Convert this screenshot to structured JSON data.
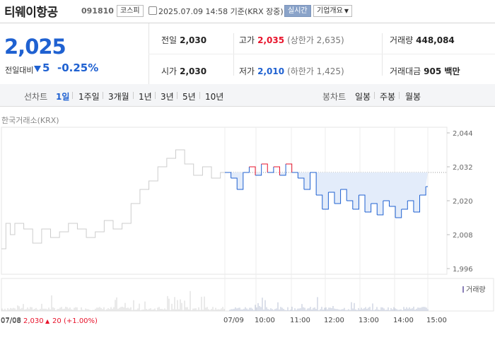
{
  "stock": {
    "name": "티웨이항공",
    "code": "091810",
    "market": "코스피",
    "datetime": "2025.07.09 14:58 기준(KRX 장중)",
    "realtime_label": "실시간",
    "company_info_label": "기업개요"
  },
  "summary": {
    "price": "2,025",
    "change_label": "전일대비",
    "change_value": "5",
    "change_rate": "-0.25%",
    "change_color": "#1f61d1",
    "prev_close": {
      "label": "전일",
      "value": "2,030"
    },
    "high": {
      "label": "고가",
      "value": "2,035",
      "sub": "(상한가 2,635)",
      "color": "#e8132b"
    },
    "volume": {
      "label": "거래량",
      "value": "448,084"
    },
    "open": {
      "label": "시가",
      "value": "2,030"
    },
    "low": {
      "label": "저가",
      "value": "2,010",
      "sub": "(하한가 1,425)",
      "color": "#1f61d1"
    },
    "trade_amount": {
      "label": "거래대금",
      "value": "905 백만"
    }
  },
  "tabs": {
    "line_chart_label": "선차트",
    "periods": [
      "1일",
      "1주일",
      "3개월",
      "1년",
      "3년",
      "5년",
      "10년"
    ],
    "active_period": "1일",
    "candle_chart_label": "봉차트",
    "candles": [
      "일봉",
      "주봉",
      "월봉"
    ]
  },
  "chart_source": "한국거래소(KRX)",
  "colors": {
    "up": "#e8132b",
    "down": "#1f61d1",
    "prev": "#cccccc",
    "fill": "#e3ecfa"
  },
  "chart_data": {
    "type": "line",
    "y_ticks": [
      "2,044",
      "2,032",
      "2,020",
      "2,008",
      "1,996"
    ],
    "ylim": [
      1996,
      2044
    ],
    "reference_price": 2030,
    "x_labels": [
      "07/08",
      "07/09",
      "10:00",
      "11:00",
      "12:00",
      "13:00",
      "14:00",
      "15:00"
    ],
    "volume_legend": "거래량",
    "prev_day_info": {
      "date": "07/08",
      "price": "2,030",
      "change": "20",
      "rate": "(+1.00%)"
    },
    "prev_day_series": [
      {
        "t": 0,
        "v": 2003
      },
      {
        "t": 0.02,
        "v": 2012
      },
      {
        "t": 0.04,
        "v": 2008
      },
      {
        "t": 0.06,
        "v": 2012
      },
      {
        "t": 0.1,
        "v": 2010
      },
      {
        "t": 0.14,
        "v": 2005
      },
      {
        "t": 0.18,
        "v": 2010
      },
      {
        "t": 0.22,
        "v": 2007
      },
      {
        "t": 0.26,
        "v": 2009
      },
      {
        "t": 0.3,
        "v": 2012
      },
      {
        "t": 0.34,
        "v": 2010
      },
      {
        "t": 0.38,
        "v": 2007
      },
      {
        "t": 0.42,
        "v": 2009
      },
      {
        "t": 0.46,
        "v": 2013
      },
      {
        "t": 0.5,
        "v": 2010
      },
      {
        "t": 0.54,
        "v": 2012
      },
      {
        "t": 0.58,
        "v": 2019
      },
      {
        "t": 0.62,
        "v": 2024
      },
      {
        "t": 0.66,
        "v": 2027
      },
      {
        "t": 0.7,
        "v": 2032
      },
      {
        "t": 0.74,
        "v": 2035
      },
      {
        "t": 0.78,
        "v": 2038
      },
      {
        "t": 0.82,
        "v": 2033
      },
      {
        "t": 0.86,
        "v": 2029
      },
      {
        "t": 0.9,
        "v": 2032
      },
      {
        "t": 0.94,
        "v": 2028
      },
      {
        "t": 0.98,
        "v": 2030
      }
    ],
    "today_series": [
      {
        "t": 0,
        "v": 2030
      },
      {
        "t": 0.03,
        "v": 2028
      },
      {
        "t": 0.06,
        "v": 2024
      },
      {
        "t": 0.09,
        "v": 2030
      },
      {
        "t": 0.12,
        "v": 2032
      },
      {
        "t": 0.15,
        "v": 2029
      },
      {
        "t": 0.18,
        "v": 2033
      },
      {
        "t": 0.21,
        "v": 2030
      },
      {
        "t": 0.24,
        "v": 2032
      },
      {
        "t": 0.27,
        "v": 2029
      },
      {
        "t": 0.3,
        "v": 2033
      },
      {
        "t": 0.33,
        "v": 2030
      },
      {
        "t": 0.36,
        "v": 2028
      },
      {
        "t": 0.39,
        "v": 2024
      },
      {
        "t": 0.42,
        "v": 2030
      },
      {
        "t": 0.45,
        "v": 2022
      },
      {
        "t": 0.48,
        "v": 2017
      },
      {
        "t": 0.51,
        "v": 2023
      },
      {
        "t": 0.54,
        "v": 2019
      },
      {
        "t": 0.57,
        "v": 2024
      },
      {
        "t": 0.6,
        "v": 2020
      },
      {
        "t": 0.63,
        "v": 2017
      },
      {
        "t": 0.66,
        "v": 2022
      },
      {
        "t": 0.69,
        "v": 2016
      },
      {
        "t": 0.72,
        "v": 2019
      },
      {
        "t": 0.75,
        "v": 2015
      },
      {
        "t": 0.78,
        "v": 2020
      },
      {
        "t": 0.81,
        "v": 2018
      },
      {
        "t": 0.84,
        "v": 2014
      },
      {
        "t": 0.87,
        "v": 2017
      },
      {
        "t": 0.9,
        "v": 2020
      },
      {
        "t": 0.93,
        "v": 2016
      },
      {
        "t": 0.96,
        "v": 2022
      },
      {
        "t": 0.99,
        "v": 2025
      }
    ]
  }
}
